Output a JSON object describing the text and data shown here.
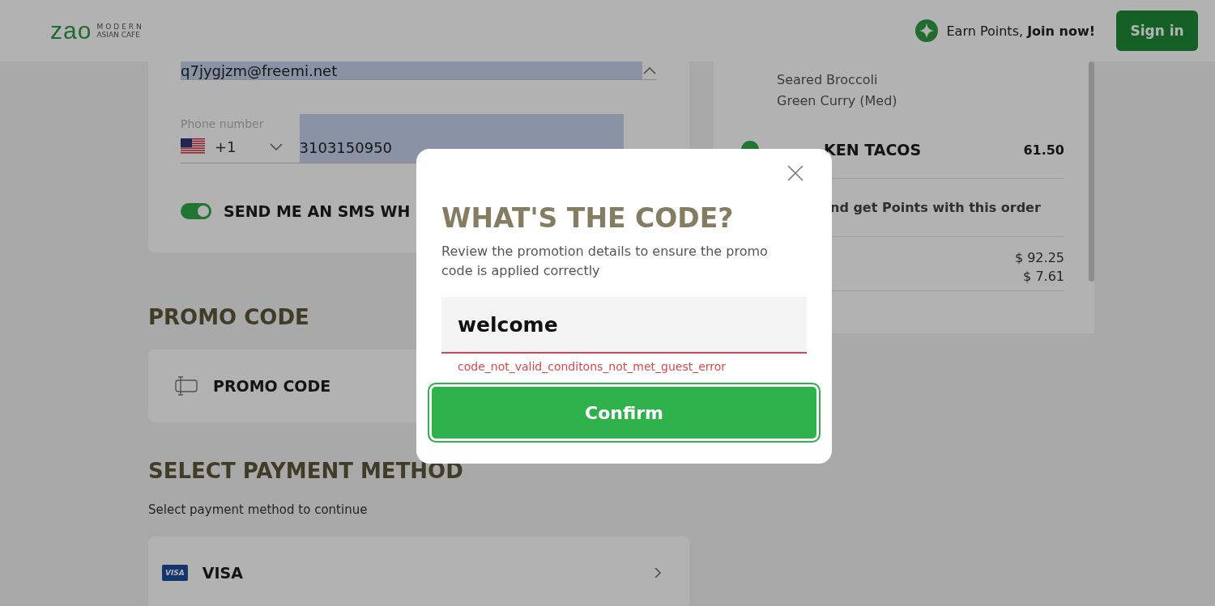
{
  "header": {
    "logo": {
      "wordmark": "zao",
      "tagline_top": "MODERN",
      "tagline_bottom": "ASIAN CAFE"
    },
    "rewards": "Earn Points, **Join now!**",
    "sign_in": "Sign in"
  },
  "contact": {
    "email": "q7jygjzm@freemi.net",
    "phone": {
      "label": "Phone number",
      "country_code": "+1",
      "number": "3103150950"
    },
    "sms_toggle": {
      "label": "SEND ME AN SMS WH",
      "on": true
    }
  },
  "promo": {
    "heading": "PROMO CODE",
    "card_label": "PROMO CODE"
  },
  "payment": {
    "heading": "SELECT PAYMENT METHOD",
    "subtitle": "Select payment method to continue",
    "methods": [
      {
        "badge": "VISA",
        "label": "VISA"
      }
    ]
  },
  "order": {
    "modifiers": [
      "Seared Broccoli",
      "Green Curry (Med)"
    ],
    "item": {
      "name": "KEN TACOS",
      "price": "61.50"
    },
    "points_text": "nd get Points with this order",
    "totals": [
      "$ 92.25",
      "$ 7.61"
    ]
  },
  "modal": {
    "title": "WHAT'S THE CODE?",
    "description": "Review the promotion details to ensure the promo code is applied correctly",
    "input_value": "welcome",
    "error": "code_not_valid_conditons_not_met_guest_error",
    "confirm": "Confirm"
  }
}
